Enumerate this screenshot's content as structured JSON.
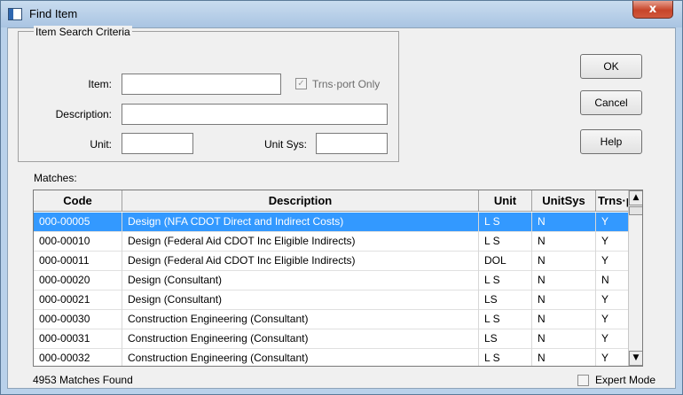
{
  "window": {
    "title": "Find Item",
    "close_label": "x"
  },
  "criteria": {
    "legend": "Item Search Criteria",
    "item_label": "Item:",
    "item_value": "",
    "trns_only_label": "Trns·port Only",
    "trns_only_checked": true,
    "description_label": "Description:",
    "description_value": "",
    "unit_label": "Unit:",
    "unit_value": "",
    "unit_sys_label": "Unit Sys:",
    "unit_sys_value": ""
  },
  "buttons": {
    "ok": "OK",
    "cancel": "Cancel",
    "help": "Help"
  },
  "matches_label": "Matches:",
  "grid": {
    "columns": [
      "Code",
      "Description",
      "Unit",
      "UnitSys",
      "Trns·pc"
    ],
    "rows": [
      {
        "code": "000-00005",
        "description": "Design (NFA CDOT Direct and Indirect Costs)",
        "unit": "L S",
        "unitsys": "N",
        "trnsport": "Y",
        "selected": true
      },
      {
        "code": "000-00010",
        "description": "Design (Federal Aid CDOT Inc Eligible Indirects)",
        "unit": "L S",
        "unitsys": "N",
        "trnsport": "Y"
      },
      {
        "code": "000-00011",
        "description": "Design (Federal Aid CDOT Inc Eligible Indirects)",
        "unit": "DOL",
        "unitsys": "N",
        "trnsport": "Y"
      },
      {
        "code": "000-00020",
        "description": "Design (Consultant)",
        "unit": "L S",
        "unitsys": "N",
        "trnsport": "N"
      },
      {
        "code": "000-00021",
        "description": "Design (Consultant)",
        "unit": "LS",
        "unitsys": "N",
        "trnsport": "Y"
      },
      {
        "code": "000-00030",
        "description": "Construction Engineering (Consultant)",
        "unit": "L S",
        "unitsys": "N",
        "trnsport": "Y"
      },
      {
        "code": "000-00031",
        "description": "Construction Engineering (Consultant)",
        "unit": "LS",
        "unitsys": "N",
        "trnsport": "Y"
      },
      {
        "code": "000-00032",
        "description": "Construction Engineering (Consultant)",
        "unit": "L S",
        "unitsys": "N",
        "trnsport": "Y"
      }
    ]
  },
  "status": {
    "matches_found": "4953 Matches Found",
    "expert_mode_label": "Expert Mode",
    "expert_mode_checked": false
  },
  "icons": {
    "title": "window-icon",
    "check": "checkmark-icon",
    "scroll_up": "scroll-up-icon",
    "scroll_down": "scroll-down-icon"
  },
  "colors": {
    "selection": "#3399ff",
    "titlebar": "#b9d1ea",
    "close": "#c7452a"
  }
}
